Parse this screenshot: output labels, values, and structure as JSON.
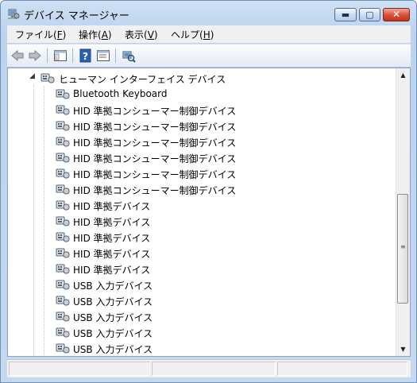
{
  "window": {
    "title": "デバイス マネージャー",
    "minimize_glyph": "▬",
    "maximize_glyph": "▢",
    "close_glyph": "✕"
  },
  "menu": {
    "items": [
      {
        "label": "ファイル(",
        "accel": "F",
        "suffix": ")"
      },
      {
        "label": "操作(",
        "accel": "A",
        "suffix": ")"
      },
      {
        "label": "表示(",
        "accel": "V",
        "suffix": ")"
      },
      {
        "label": "ヘルプ(",
        "accel": "H",
        "suffix": ")"
      }
    ]
  },
  "toolbar": {
    "buttons": [
      "back-arrow-icon",
      "forward-arrow-icon",
      "show-hide-console-tree-icon",
      "help-icon",
      "properties-icon",
      "scan-hardware-icon"
    ]
  },
  "tree": {
    "group_label": "ヒューマン インターフェイス デバイス",
    "expand_glyph": "◢",
    "devices": [
      "Bluetooth Keyboard",
      "HID 準拠コンシューマー制御デバイス",
      "HID 準拠コンシューマー制御デバイス",
      "HID 準拠コンシューマー制御デバイス",
      "HID 準拠コンシューマー制御デバイス",
      "HID 準拠コンシューマー制御デバイス",
      "HID 準拠コンシューマー制御デバイス",
      "HID 準拠デバイス",
      "HID 準拠デバイス",
      "HID 準拠デバイス",
      "HID 準拠デバイス",
      "HID 準拠デバイス",
      "USB 入力デバイス",
      "USB 入力デバイス",
      "USB 入力デバイス",
      "USB 入力デバイス",
      "USB 入力デバイス"
    ]
  },
  "scrollbar": {
    "up_glyph": "▲",
    "down_glyph": "▼",
    "grip_glyph": "≡"
  },
  "colors": {
    "window_border": "#6f8fb5",
    "close_red": "#c0321a"
  }
}
